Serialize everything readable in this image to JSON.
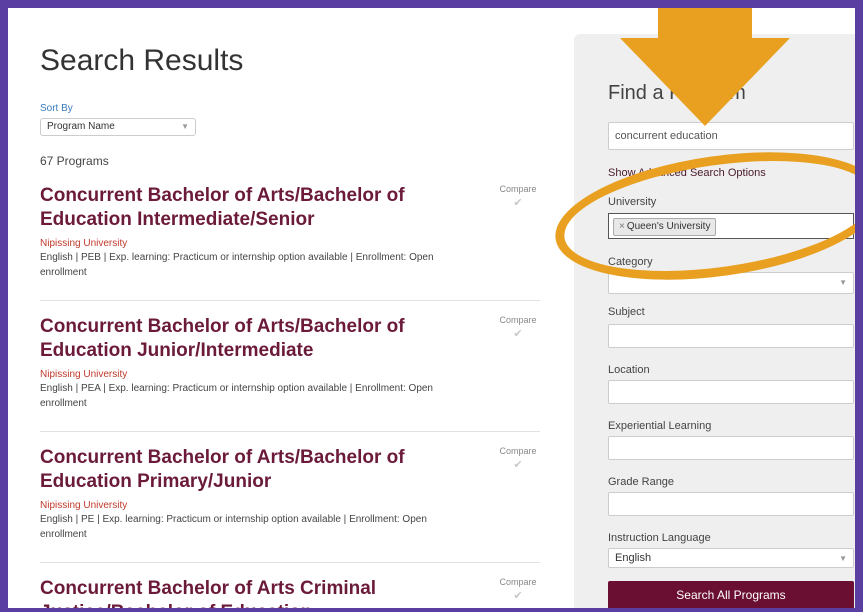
{
  "page": {
    "title": "Search Results",
    "sort_label": "Sort By",
    "sort_value": "Program Name",
    "count_text": "67 Programs"
  },
  "results": [
    {
      "title": "Concurrent Bachelor of Arts/Bachelor of Education Intermediate/Senior",
      "university": "Nipissing University",
      "meta": "English | PEB | Exp. learning: Practicum or internship option available | Enrollment: Open enrollment",
      "compare_label": "Compare"
    },
    {
      "title": "Concurrent Bachelor of Arts/Bachelor of Education Junior/Intermediate",
      "university": "Nipissing University",
      "meta": "English | PEA | Exp. learning: Practicum or internship option available | Enrollment: Open enrollment",
      "compare_label": "Compare"
    },
    {
      "title": "Concurrent Bachelor of Arts/Bachelor of Education Primary/Junior",
      "university": "Nipissing University",
      "meta": "English | PE | Exp. learning: Practicum or internship option available | Enrollment: Open enrollment",
      "compare_label": "Compare"
    },
    {
      "title": "Concurrent Bachelor of Arts Criminal Justice/Bachelor of Education",
      "compare_label": "Compare"
    }
  ],
  "panel": {
    "title": "Find a Program",
    "search_value": "concurrent education",
    "advanced_link": "Show Advanced Search Options",
    "university_label": "University",
    "university_tag": "Queen's University",
    "category_label": "Category",
    "subject_label": "Subject",
    "location_label": "Location",
    "experiential_label": "Experiential Learning",
    "grade_label": "Grade Range",
    "language_label": "Instruction Language",
    "language_value": "English",
    "search_button": "Search All Programs"
  },
  "icons": {
    "compare": "checkmark-icon",
    "dropdown": "chevron-down-icon",
    "remove_tag": "close-icon"
  },
  "colors": {
    "frame": "#5a3ea1",
    "title_link": "#6b1a3a",
    "university_link": "#c0392b",
    "button": "#6b0f32",
    "annotation": "#e9a020"
  }
}
